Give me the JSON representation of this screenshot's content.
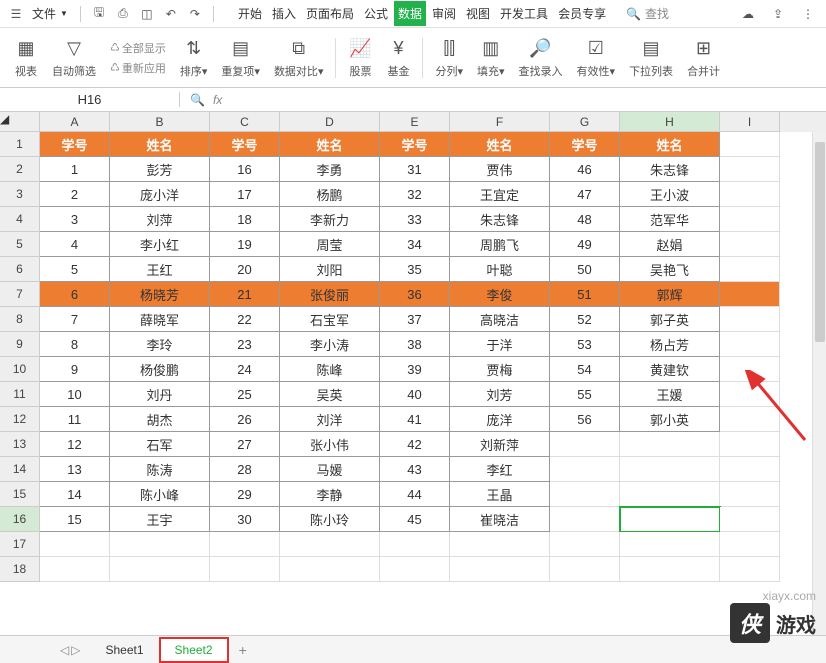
{
  "menubar": {
    "file_label": "文件",
    "tabs": [
      "开始",
      "插入",
      "页面布局",
      "公式",
      "数据",
      "审阅",
      "视图",
      "开发工具",
      "会员专享"
    ],
    "active_tab": "数据",
    "search_placeholder": "查找"
  },
  "ribbon": {
    "pivot": "视表",
    "autofilter": "自动筛选",
    "show_all": "全部显示",
    "reapply": "重新应用",
    "sort": "排序",
    "duplicates": "重复项",
    "data_compare": "数据对比",
    "stock": "股票",
    "fund": "基金",
    "split_col": "分列",
    "fill": "填充",
    "find_input": "查找录入",
    "validity": "有效性",
    "dropdown": "下拉列表",
    "consolidate": "合并计"
  },
  "namebox": "H16",
  "columns": [
    "A",
    "B",
    "C",
    "D",
    "E",
    "F",
    "G",
    "H",
    "I"
  ],
  "headers": [
    "学号",
    "姓名",
    "学号",
    "姓名",
    "学号",
    "姓名",
    "学号",
    "姓名"
  ],
  "rows": [
    [
      "1",
      "彭芳",
      "16",
      "李勇",
      "31",
      "贾伟",
      "46",
      "朱志锋"
    ],
    [
      "2",
      "庞小洋",
      "17",
      "杨鹏",
      "32",
      "王宜定",
      "47",
      "王小波"
    ],
    [
      "3",
      "刘萍",
      "18",
      "李新力",
      "33",
      "朱志锋",
      "48",
      "范军华"
    ],
    [
      "4",
      "李小红",
      "19",
      "周莹",
      "34",
      "周鹏飞",
      "49",
      "赵娟"
    ],
    [
      "5",
      "王红",
      "20",
      "刘阳",
      "35",
      "叶聪",
      "50",
      "吴艳飞"
    ],
    [
      "6",
      "杨晓芳",
      "21",
      "张俊丽",
      "36",
      "李俊",
      "51",
      "郭辉"
    ],
    [
      "7",
      "薛晓军",
      "22",
      "石宝军",
      "37",
      "高晓洁",
      "52",
      "郭子英"
    ],
    [
      "8",
      "李玲",
      "23",
      "李小涛",
      "38",
      "于洋",
      "53",
      "杨占芳"
    ],
    [
      "9",
      "杨俊鹏",
      "24",
      "陈峰",
      "39",
      "贾梅",
      "54",
      "黄建钦"
    ],
    [
      "10",
      "刘丹",
      "25",
      "吴英",
      "40",
      "刘芳",
      "55",
      "王媛"
    ],
    [
      "11",
      "胡杰",
      "26",
      "刘洋",
      "41",
      "庞洋",
      "56",
      "郭小英"
    ],
    [
      "12",
      "石军",
      "27",
      "张小伟",
      "42",
      "刘新萍",
      "",
      ""
    ],
    [
      "13",
      "陈涛",
      "28",
      "马媛",
      "43",
      "李红",
      "",
      ""
    ],
    [
      "14",
      "陈小峰",
      "29",
      "李静",
      "44",
      "王晶",
      "",
      ""
    ],
    [
      "15",
      "王宇",
      "30",
      "陈小玲",
      "45",
      "崔晓洁",
      "",
      ""
    ]
  ],
  "highlight_row_index": 5,
  "active_cell": {
    "row": 15,
    "col": 7
  },
  "sheets": [
    "Sheet1",
    "Sheet2"
  ],
  "active_sheet": "Sheet2",
  "watermark": {
    "brand": "侠",
    "text": "游戏",
    "url": "xiayx.com"
  },
  "chart_data": {
    "type": "table",
    "description": "Spreadsheet with student ID (学号) and name (姓名) pairs across 4 column groups, rows 1-56"
  }
}
